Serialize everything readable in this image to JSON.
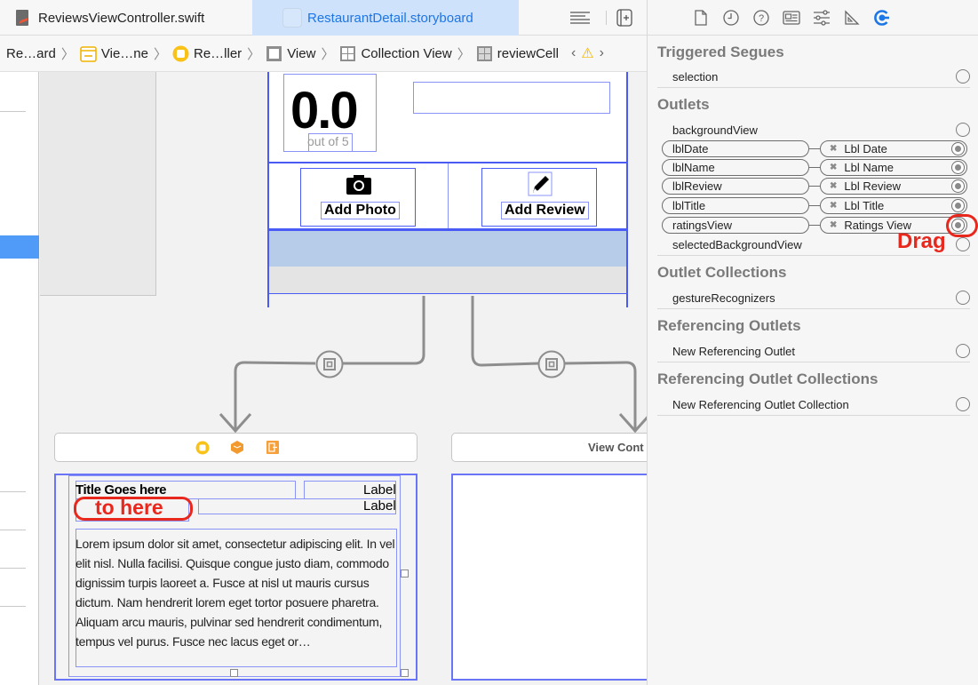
{
  "tabs": [
    {
      "label": "ReviewsViewController.swift",
      "icon": "swift-file-icon",
      "active": false
    },
    {
      "label": "RestaurantDetail.storyboard",
      "icon": "storyboard-file-icon",
      "active": true
    }
  ],
  "toolbar": {
    "editor_options_icon": "lines-icon",
    "add_editor_icon": "add-editor-icon"
  },
  "breadcrumb": [
    {
      "label": "Re…ard",
      "icon": null
    },
    {
      "label": "Vie…ne",
      "icon": "scene-icon"
    },
    {
      "label": "Re…ller",
      "icon": "view-controller-icon"
    },
    {
      "label": "View",
      "icon": "view-icon"
    },
    {
      "label": "Collection View",
      "icon": "collection-view-icon"
    },
    {
      "label": "reviewCell",
      "icon": "collection-cell-icon"
    }
  ],
  "breadcrumb_nav": {
    "prev": "‹",
    "next": "›",
    "warning": "⚠"
  },
  "canvas": {
    "rating_value": "0.0",
    "rating_caption": "out of 5",
    "actions": [
      {
        "label": "Add Photo",
        "icon": "camera-icon"
      },
      {
        "label": "Add Review",
        "icon": "pencil-icon"
      }
    ],
    "review_cell": {
      "title": "Title Goes here",
      "label_1": "Label",
      "label_2": "Label",
      "body": "Lorem ipsum dolor sit amet, consectetur adipiscing elit. In vel elit nisl. Nulla facilisi. Quisque congue justo diam, commodo dignissim turpis laoreet a. Fusce at nisl ut mauris cursus dictum. Nam hendrerit lorem eget tortor posuere pharetra. Aliquam arcu mauris, pulvinar sed hendrerit condimentum, tempus vel purus. Fusce nec lacus eget or…"
    },
    "second_scene_title": "View Cont",
    "annotation_target": "to here",
    "annotation_drag": "Drag",
    "accent_red": "#e8271d",
    "selection_blue": "#4a5af5"
  },
  "inspector": {
    "tabs": [
      {
        "name": "file-inspector",
        "icon": "document-icon"
      },
      {
        "name": "history-inspector",
        "icon": "clock-icon"
      },
      {
        "name": "quick-help",
        "icon": "question-icon"
      },
      {
        "name": "identity-inspector",
        "icon": "id-card-icon"
      },
      {
        "name": "attributes-inspector",
        "icon": "sliders-icon"
      },
      {
        "name": "size-inspector",
        "icon": "ruler-icon"
      },
      {
        "name": "connections-inspector",
        "icon": "connections-icon",
        "active": true
      }
    ],
    "sections": {
      "triggered_segues": {
        "title": "Triggered Segues",
        "rows": [
          "selection"
        ]
      },
      "outlets": {
        "title": "Outlets",
        "rows": [
          {
            "name": "backgroundView",
            "connected": null
          },
          {
            "name": "lblDate",
            "connected": "Lbl Date"
          },
          {
            "name": "lblName",
            "connected": "Lbl Name"
          },
          {
            "name": "lblReview",
            "connected": "Lbl Review"
          },
          {
            "name": "lblTitle",
            "connected": "Lbl Title"
          },
          {
            "name": "ratingsView",
            "connected": "Ratings View"
          },
          {
            "name": "selectedBackgroundView",
            "connected": null
          }
        ]
      },
      "outlet_collections": {
        "title": "Outlet Collections",
        "rows": [
          "gestureRecognizers"
        ]
      },
      "referencing_outlets": {
        "title": "Referencing Outlets",
        "rows": [
          "New Referencing Outlet"
        ]
      },
      "referencing_outlet_collections": {
        "title": "Referencing Outlet Collections",
        "rows": [
          "New Referencing Outlet Collection"
        ]
      }
    }
  }
}
